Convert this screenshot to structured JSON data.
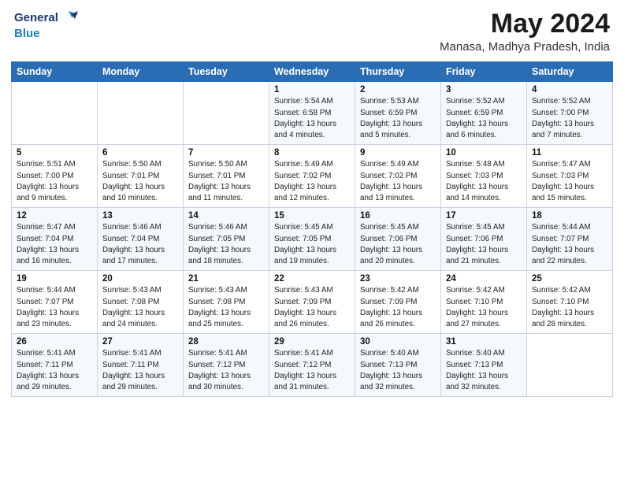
{
  "header": {
    "logo_line1": "General",
    "logo_line2": "Blue",
    "month_year": "May 2024",
    "location": "Manasa, Madhya Pradesh, India"
  },
  "days_of_week": [
    "Sunday",
    "Monday",
    "Tuesday",
    "Wednesday",
    "Thursday",
    "Friday",
    "Saturday"
  ],
  "weeks": [
    [
      {
        "day": "",
        "info": ""
      },
      {
        "day": "",
        "info": ""
      },
      {
        "day": "",
        "info": ""
      },
      {
        "day": "1",
        "info": "Sunrise: 5:54 AM\nSunset: 6:58 PM\nDaylight: 13 hours\nand 4 minutes."
      },
      {
        "day": "2",
        "info": "Sunrise: 5:53 AM\nSunset: 6:59 PM\nDaylight: 13 hours\nand 5 minutes."
      },
      {
        "day": "3",
        "info": "Sunrise: 5:52 AM\nSunset: 6:59 PM\nDaylight: 13 hours\nand 6 minutes."
      },
      {
        "day": "4",
        "info": "Sunrise: 5:52 AM\nSunset: 7:00 PM\nDaylight: 13 hours\nand 7 minutes."
      }
    ],
    [
      {
        "day": "5",
        "info": "Sunrise: 5:51 AM\nSunset: 7:00 PM\nDaylight: 13 hours\nand 9 minutes."
      },
      {
        "day": "6",
        "info": "Sunrise: 5:50 AM\nSunset: 7:01 PM\nDaylight: 13 hours\nand 10 minutes."
      },
      {
        "day": "7",
        "info": "Sunrise: 5:50 AM\nSunset: 7:01 PM\nDaylight: 13 hours\nand 11 minutes."
      },
      {
        "day": "8",
        "info": "Sunrise: 5:49 AM\nSunset: 7:02 PM\nDaylight: 13 hours\nand 12 minutes."
      },
      {
        "day": "9",
        "info": "Sunrise: 5:49 AM\nSunset: 7:02 PM\nDaylight: 13 hours\nand 13 minutes."
      },
      {
        "day": "10",
        "info": "Sunrise: 5:48 AM\nSunset: 7:03 PM\nDaylight: 13 hours\nand 14 minutes."
      },
      {
        "day": "11",
        "info": "Sunrise: 5:47 AM\nSunset: 7:03 PM\nDaylight: 13 hours\nand 15 minutes."
      }
    ],
    [
      {
        "day": "12",
        "info": "Sunrise: 5:47 AM\nSunset: 7:04 PM\nDaylight: 13 hours\nand 16 minutes."
      },
      {
        "day": "13",
        "info": "Sunrise: 5:46 AM\nSunset: 7:04 PM\nDaylight: 13 hours\nand 17 minutes."
      },
      {
        "day": "14",
        "info": "Sunrise: 5:46 AM\nSunset: 7:05 PM\nDaylight: 13 hours\nand 18 minutes."
      },
      {
        "day": "15",
        "info": "Sunrise: 5:45 AM\nSunset: 7:05 PM\nDaylight: 13 hours\nand 19 minutes."
      },
      {
        "day": "16",
        "info": "Sunrise: 5:45 AM\nSunset: 7:06 PM\nDaylight: 13 hours\nand 20 minutes."
      },
      {
        "day": "17",
        "info": "Sunrise: 5:45 AM\nSunset: 7:06 PM\nDaylight: 13 hours\nand 21 minutes."
      },
      {
        "day": "18",
        "info": "Sunrise: 5:44 AM\nSunset: 7:07 PM\nDaylight: 13 hours\nand 22 minutes."
      }
    ],
    [
      {
        "day": "19",
        "info": "Sunrise: 5:44 AM\nSunset: 7:07 PM\nDaylight: 13 hours\nand 23 minutes."
      },
      {
        "day": "20",
        "info": "Sunrise: 5:43 AM\nSunset: 7:08 PM\nDaylight: 13 hours\nand 24 minutes."
      },
      {
        "day": "21",
        "info": "Sunrise: 5:43 AM\nSunset: 7:08 PM\nDaylight: 13 hours\nand 25 minutes."
      },
      {
        "day": "22",
        "info": "Sunrise: 5:43 AM\nSunset: 7:09 PM\nDaylight: 13 hours\nand 26 minutes."
      },
      {
        "day": "23",
        "info": "Sunrise: 5:42 AM\nSunset: 7:09 PM\nDaylight: 13 hours\nand 26 minutes."
      },
      {
        "day": "24",
        "info": "Sunrise: 5:42 AM\nSunset: 7:10 PM\nDaylight: 13 hours\nand 27 minutes."
      },
      {
        "day": "25",
        "info": "Sunrise: 5:42 AM\nSunset: 7:10 PM\nDaylight: 13 hours\nand 28 minutes."
      }
    ],
    [
      {
        "day": "26",
        "info": "Sunrise: 5:41 AM\nSunset: 7:11 PM\nDaylight: 13 hours\nand 29 minutes."
      },
      {
        "day": "27",
        "info": "Sunrise: 5:41 AM\nSunset: 7:11 PM\nDaylight: 13 hours\nand 29 minutes."
      },
      {
        "day": "28",
        "info": "Sunrise: 5:41 AM\nSunset: 7:12 PM\nDaylight: 13 hours\nand 30 minutes."
      },
      {
        "day": "29",
        "info": "Sunrise: 5:41 AM\nSunset: 7:12 PM\nDaylight: 13 hours\nand 31 minutes."
      },
      {
        "day": "30",
        "info": "Sunrise: 5:40 AM\nSunset: 7:13 PM\nDaylight: 13 hours\nand 32 minutes."
      },
      {
        "day": "31",
        "info": "Sunrise: 5:40 AM\nSunset: 7:13 PM\nDaylight: 13 hours\nand 32 minutes."
      },
      {
        "day": "",
        "info": ""
      }
    ]
  ]
}
